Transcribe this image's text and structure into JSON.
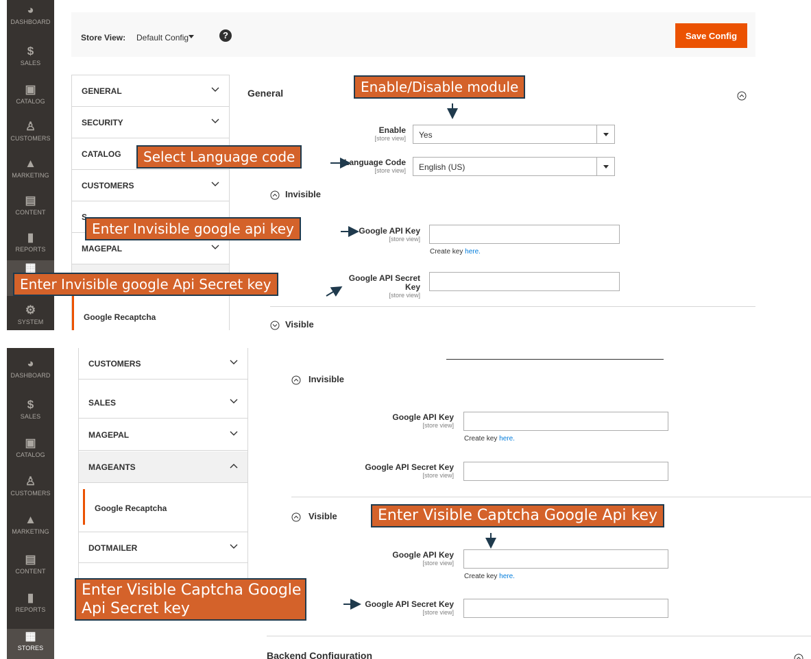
{
  "nav": [
    {
      "id": "dashboard",
      "label": "DASHBOARD",
      "icon": "dashboard-icon"
    },
    {
      "id": "sales",
      "label": "SALES",
      "icon": "dollar-icon"
    },
    {
      "id": "catalog",
      "label": "CATALOG",
      "icon": "cube-icon"
    },
    {
      "id": "customers",
      "label": "CUSTOMERS",
      "icon": "person-icon"
    },
    {
      "id": "marketing",
      "label": "MARKETING",
      "icon": "megaphone-icon"
    },
    {
      "id": "content",
      "label": "CONTENT",
      "icon": "layout-icon"
    },
    {
      "id": "reports",
      "label": "REPORTS",
      "icon": "bar-chart-icon"
    },
    {
      "id": "stores",
      "label": "STORES",
      "icon": "shop-icon"
    },
    {
      "id": "system",
      "label": "SYSTEM",
      "icon": "gear-icon"
    }
  ],
  "store_view": {
    "label": "Store View:",
    "value": "Default Config",
    "help": "?"
  },
  "save_button": "Save Config",
  "tabs_top": [
    "GENERAL",
    "SECURITY",
    "CATALOG",
    "CUSTOMERS",
    "S",
    "MAGEPAL"
  ],
  "tabs_bottom": [
    "CUSTOMERS",
    "SALES",
    "MAGEPAL",
    "MAGEANTS",
    "DOTMAILER"
  ],
  "active_item": "Google Recaptcha",
  "general": {
    "title": "General",
    "enable_label": "Enable",
    "enable_value": "Yes",
    "language_label": "Language Code",
    "language_value": "English (US)",
    "scope": "[store view]"
  },
  "invisible": {
    "title": "Invisible",
    "api_key_label": "Google API Key",
    "secret_label": "Google API Secret Key",
    "create_key": "Create key",
    "here": "here."
  },
  "visible": {
    "title": "Visible",
    "api_key_label": "Google API Key",
    "secret_label": "Google API Secret Key",
    "create_key": "Create key",
    "here": "here."
  },
  "backend": {
    "title": "Backend Configuration"
  },
  "callouts": {
    "enable_module": "Enable/Disable module",
    "language": "Select Language code",
    "invisible_key": "Enter Invisible google api key",
    "invisible_secret": "Enter Invisible google Api Secret key",
    "visible_key": "Enter Visible Captcha Google Api key",
    "visible_secret_line1": "Enter Visible Captcha Google",
    "visible_secret_line2": "Api Secret key"
  },
  "colors": {
    "accent": "#eb5202",
    "callout_fill": "#d4622a",
    "callout_border": "#1f3a4d",
    "nav_bg": "#373330",
    "link": "#007bdb"
  }
}
